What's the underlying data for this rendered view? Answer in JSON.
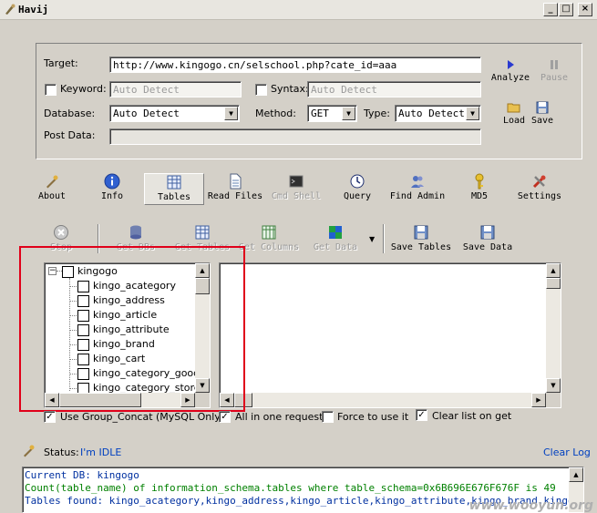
{
  "window": {
    "title": "Havij",
    "minimize": "_",
    "maximize": "□",
    "close": "×"
  },
  "form": {
    "target_label": "Target:",
    "target_value": "http://www.kingogo.cn/selschool.php?cate_id=aaa",
    "keyword_label": "Keyword:",
    "keyword_placeholder": "Auto Detect",
    "syntax_label": "Syntax:",
    "syntax_placeholder": "Auto Detect",
    "database_label": "Database:",
    "database_value": "Auto Detect",
    "method_label": "Method:",
    "method_value": "GET",
    "type_label": "Type:",
    "type_value": "Auto Detect",
    "postdata_label": "Post Data:",
    "postdata_value": ""
  },
  "side_buttons": {
    "analyze": "Analyze",
    "pause": "Pause",
    "load": "Load",
    "save": "Save"
  },
  "tabs": [
    {
      "label": "About"
    },
    {
      "label": "Info"
    },
    {
      "label": "Tables"
    },
    {
      "label": "Read Files"
    },
    {
      "label": "Cmd Shell"
    },
    {
      "label": "Query"
    },
    {
      "label": "Find Admin"
    },
    {
      "label": "MD5"
    },
    {
      "label": "Settings"
    }
  ],
  "toolbar": {
    "stop": "Stop",
    "get_dbs": "Get DBs",
    "get_tables": "Get Tables",
    "get_columns": "Get Columns",
    "get_data": "Get Data",
    "save_tables": "Save Tables",
    "save_data": "Save Data"
  },
  "tree": {
    "root": "kingogo",
    "items": [
      "kingo_acategory",
      "kingo_address",
      "kingo_article",
      "kingo_attribute",
      "kingo_brand",
      "kingo_cart",
      "kingo_category_goods",
      "kingo_category_store"
    ]
  },
  "options": {
    "group_concat": "Use Group_Concat (MySQL Only)",
    "group_concat_checked": true,
    "all_in_one": "All in one request.",
    "all_in_one_checked": true,
    "force": "Force to use it",
    "force_checked": false,
    "clear_list": "Clear list on get",
    "clear_list_checked": true
  },
  "status": {
    "label": "Status:",
    "value": "I'm IDLE",
    "clear_log": "Clear Log"
  },
  "log": {
    "line1": "Current DB: kingogo",
    "line2": "Count(table_name) of information_schema.tables where table_schema=0x6B696E676F676F is 49",
    "line3": "Tables found: kingo_acategory,kingo_address,kingo_article,kingo_attribute,kingo_brand,kingo_cart,king"
  },
  "watermark": "www.wooyun.org",
  "colors": {
    "highlight_box": "#e0001a",
    "status_blue": "#0040c0",
    "log_green": "#008000"
  }
}
